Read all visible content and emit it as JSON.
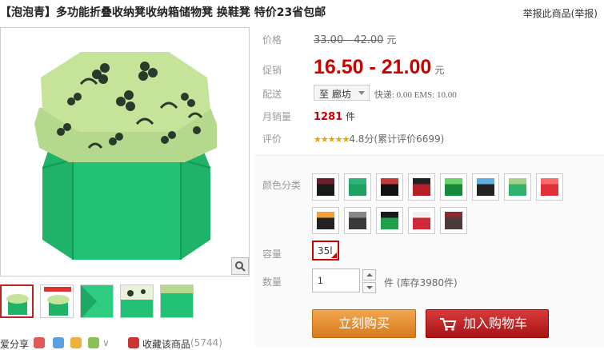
{
  "header": {
    "product_title": "【泡泡青】多功能折叠收纳凳收纳箱储物凳 换鞋凳 特价23省包邮",
    "report_link": "举报此商品(举报)"
  },
  "gallery": {
    "thumb_count": 5
  },
  "share": {
    "share_label": "爱分享",
    "favorite_label": "收藏该商品",
    "favorite_count": "(5744)"
  },
  "info": {
    "price_label": "价格",
    "original_price": "33.00 - 42.00",
    "currency": "元",
    "promo_label": "促销",
    "promo_price": "16.50 - 21.00",
    "delivery_label": "配送",
    "delivery_dest": "至 廊坊",
    "shipping_text": "快递: 0.00 EMS: 10.00",
    "sales_label": "月销量",
    "sales_count": "1281",
    "sales_unit": "件",
    "rating_label": "评价",
    "stars": "★★★★★",
    "rating_text": "4.8分(累计评价6699)"
  },
  "options": {
    "color_label": "颜色分类",
    "color_swatches": [
      {
        "top": "#6b1f2a",
        "body": "#1a1a1a"
      },
      {
        "top": "#2eb37a",
        "body": "#20a060"
      },
      {
        "top": "#c23a3a",
        "body": "#111111"
      },
      {
        "top": "#222222",
        "body": "#b81e28"
      },
      {
        "top": "#6ad36a",
        "body": "#148a3a"
      },
      {
        "top": "#5fb0e0",
        "body": "#222222"
      },
      {
        "top": "#a6d08a",
        "body": "#2eb36e"
      },
      {
        "top": "#ff6b6b",
        "body": "#e0303a"
      },
      {
        "top": "#f2a13a",
        "body": "#222222"
      },
      {
        "top": "#888888",
        "body": "#3a3a3a"
      },
      {
        "top": "#1a1a1a",
        "body": "#1fa04a"
      },
      {
        "top": "#f0f0f0",
        "body": "#d0283a"
      },
      {
        "top": "#8a2a2a",
        "body": "#4a3a3a"
      }
    ],
    "capacity_label": "容量",
    "capacity_value": "35l",
    "quantity_label": "数量",
    "quantity_value": "1",
    "stock_text": "件 (库存3980件)"
  },
  "actions": {
    "buy_now": "立刻购买",
    "add_to_cart": "加入购物车"
  }
}
